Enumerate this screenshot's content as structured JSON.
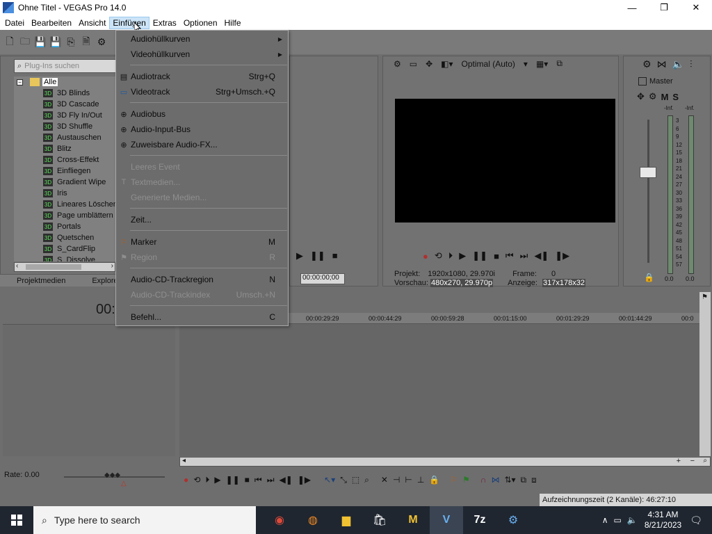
{
  "window": {
    "title": "Ohne Titel - VEGAS Pro 14.0",
    "controls": {
      "minimize": "—",
      "maximize": "❐",
      "close": "✕"
    }
  },
  "menubar": {
    "items": [
      "Datei",
      "Bearbeiten",
      "Ansicht",
      "Einfügen",
      "Extras",
      "Optionen",
      "Hilfe"
    ],
    "active": "Einfügen"
  },
  "explorer": {
    "search_placeholder": "Plug-Ins suchen",
    "root": "Alle",
    "items": [
      "3D Blinds",
      "3D Cascade",
      "3D Fly In/Out",
      "3D Shuffle",
      "Austauschen",
      "Blitz",
      "Cross-Effekt",
      "Einfliegen",
      "Gradient Wipe",
      "Iris",
      "Lineares Löschen",
      "Page umblättern",
      "Portals",
      "Quetschen",
      "S_CardFlip",
      "S_Dissolve"
    ],
    "tabs": [
      "Projektmedien",
      "Explorer"
    ]
  },
  "trimmer": {
    "timecode": "00:00:00;00"
  },
  "preview": {
    "quality": "Optimal (Auto)",
    "projekt_label": "Projekt:",
    "projekt_value": "1920x1080, 29.970i",
    "frame_label": "Frame:",
    "frame_value": "0",
    "vorschau_label": "Vorschau:",
    "vorschau_value": "480x270, 29.970p",
    "anzeige_label": "Anzeige:",
    "anzeige_value": "317x178x32"
  },
  "master": {
    "label": "Master",
    "buttons": [
      "M",
      "S"
    ],
    "peak_left": "-Inf.",
    "peak_right": "-Inf.",
    "scale": [
      "3",
      "6",
      "9",
      "12",
      "15",
      "18",
      "21",
      "24",
      "27",
      "30",
      "33",
      "36",
      "39",
      "42",
      "45",
      "48",
      "51",
      "54",
      "57"
    ],
    "value_left": "0.0",
    "value_right": "0.0"
  },
  "timeline": {
    "timecode": "00:",
    "rate": "Rate: 0.00",
    "ruler": [
      "00:00:29:29",
      "00:00:44:29",
      "00:00:59:28",
      "00:01:15:00",
      "00:01:29:29",
      "00:01:44:29",
      "00:0"
    ]
  },
  "status": {
    "recording_time": "Aufzeichnungszeit (2 Kanäle): 46:27:10"
  },
  "insert_menu": {
    "items": [
      {
        "label": "Audiohüllkurven",
        "shortcut": "",
        "submenu": true,
        "disabled": false,
        "icon": ""
      },
      {
        "label": "Videohüllkurven",
        "shortcut": "",
        "submenu": true,
        "disabled": false,
        "icon": ""
      },
      {
        "label": "Audiotrack",
        "shortcut": "Strg+Q",
        "submenu": false,
        "disabled": false,
        "icon": "audio-track-icon"
      },
      {
        "label": "Videotrack",
        "shortcut": "Strg+Umsch.+Q",
        "submenu": false,
        "disabled": false,
        "icon": "video-track-icon"
      },
      {
        "label": "Audiobus",
        "shortcut": "",
        "submenu": false,
        "disabled": false,
        "icon": "audio-bus-icon"
      },
      {
        "label": "Audio-Input-Bus",
        "shortcut": "",
        "submenu": false,
        "disabled": false,
        "icon": "input-bus-icon"
      },
      {
        "label": "Zuweisbare Audio-FX...",
        "shortcut": "",
        "submenu": false,
        "disabled": false,
        "icon": "assignable-fx-icon"
      },
      {
        "label": "Leeres Event",
        "shortcut": "",
        "submenu": false,
        "disabled": true,
        "icon": ""
      },
      {
        "label": "Textmedien...",
        "shortcut": "",
        "submenu": false,
        "disabled": true,
        "icon": "text-media-icon"
      },
      {
        "label": "Generierte Medien...",
        "shortcut": "",
        "submenu": false,
        "disabled": true,
        "icon": ""
      },
      {
        "label": "Zeit...",
        "shortcut": "",
        "submenu": false,
        "disabled": false,
        "icon": ""
      },
      {
        "label": "Marker",
        "shortcut": "M",
        "submenu": false,
        "disabled": false,
        "icon": "marker-icon"
      },
      {
        "label": "Region",
        "shortcut": "R",
        "submenu": false,
        "disabled": true,
        "icon": "region-icon"
      },
      {
        "label": "Audio-CD-Trackregion",
        "shortcut": "N",
        "submenu": false,
        "disabled": false,
        "icon": ""
      },
      {
        "label": "Audio-CD-Trackindex",
        "shortcut": "Umsch.+N",
        "submenu": false,
        "disabled": true,
        "icon": ""
      },
      {
        "label": "Befehl...",
        "shortcut": "C",
        "submenu": false,
        "disabled": false,
        "icon": ""
      }
    ]
  },
  "taskbar": {
    "search_placeholder": "Type here to search",
    "time": "4:31 AM",
    "date": "8/21/2023",
    "apps": [
      "chrome-icon",
      "firefox-icon",
      "file-explorer-icon",
      "store-icon",
      "app-m-icon",
      "vegas-icon",
      "7zip-icon",
      "app-gear-icon"
    ]
  },
  "colors": {
    "menu_hover": "#cce4f7",
    "panel_bg": "#727272",
    "video_bg": "#000000"
  }
}
